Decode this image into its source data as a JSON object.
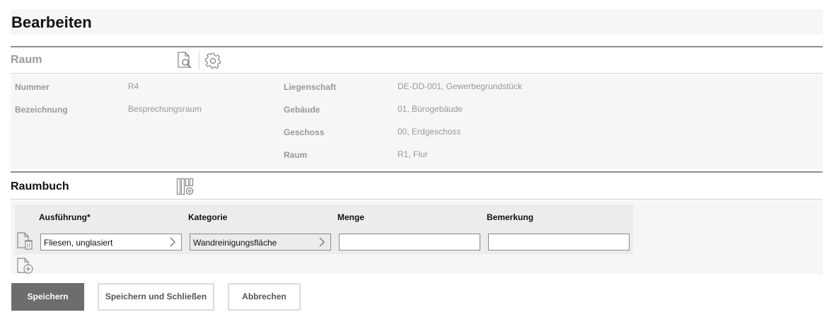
{
  "page": {
    "title": "Bearbeiten"
  },
  "raum": {
    "title": "Raum",
    "fields": [
      {
        "label": "Nummer",
        "value": "R4"
      },
      {
        "label": "Bezeichnung",
        "value": "Besprechungsraum"
      },
      {
        "label": "Liegenschaft",
        "value": "DE-DD-001, Gewerbegrundstück"
      },
      {
        "label": "Gebäude",
        "value": "01, Bürogebäude"
      },
      {
        "label": "Geschoss",
        "value": "00, Erdgeschoss"
      },
      {
        "label": "Raum",
        "value": "R1, Flur"
      }
    ]
  },
  "raumbuch": {
    "title": "Raumbuch",
    "columns": [
      "Ausführung*",
      "Kategorie",
      "Menge",
      "Bemerkung"
    ],
    "rows": [
      {
        "ausfuehrung": "Fliesen, unglasiert",
        "kategorie": "Wandreinigungsfläche",
        "menge": "",
        "bemerkung": ""
      }
    ]
  },
  "buttons": {
    "save": "Speichern",
    "save_close": "Speichern und Schließen",
    "cancel": "Abbrechen"
  },
  "icons": {
    "raum_search": "document-search-icon",
    "raum_settings": "gear-icon",
    "raumbuch_columns": "column-settings-icon",
    "row_delete": "document-delete-icon",
    "row_add": "document-add-icon",
    "field_open": "chevron-right-icon"
  },
  "colors": {
    "primary_button": "#6d6d6d",
    "panel_bg": "#f6f6f6"
  }
}
